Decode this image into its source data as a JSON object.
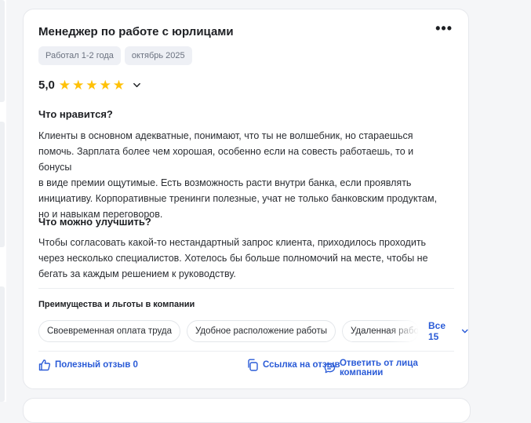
{
  "review": {
    "title": "Менеджер по работе с юрлицами",
    "menu_glyph": "•••",
    "tags": [
      "Работал 1-2 года",
      "октябрь 2025"
    ],
    "rating_value": "5,0",
    "stars": 5,
    "likes_title": "Что нравится?",
    "likes_lines": [
      "Клиенты в основном адекватные, понимают, что ты не волшебник, но стараешься",
      "помочь. Зарплата более чем хорошая, особенно если на совесть работаешь, то и бонусы",
      "в виде премии ощутимые. Есть возможность расти внутри банка, если проявлять",
      "инициативу. Корпоративные тренинги полезные, учат не только банковским продуктам,",
      "но и навыкам переговоров."
    ],
    "improve_title": "Что можно улучшить?",
    "improve_lines": [
      "Чтобы согласовать какой-то нестандартный запрос клиента, приходилось проходить",
      "через несколько специалистов. Хотелось бы больше полномочий на месте, чтобы не",
      "бегать за каждым решением к руководству."
    ],
    "benefits_title": "Преимущества и льготы в компании",
    "benefits": [
      "Своевременная оплата труда",
      "Удобное расположение работы",
      "Удаленная работа"
    ],
    "all_benefits": "Все 15",
    "useful_label": "Полезный отзыв 0",
    "link_label": "Ссылка на отзыв",
    "reply_label": "Ответить от лица компании"
  },
  "colors": {
    "accent": "#2a5bd7",
    "star": "#ffc107"
  }
}
